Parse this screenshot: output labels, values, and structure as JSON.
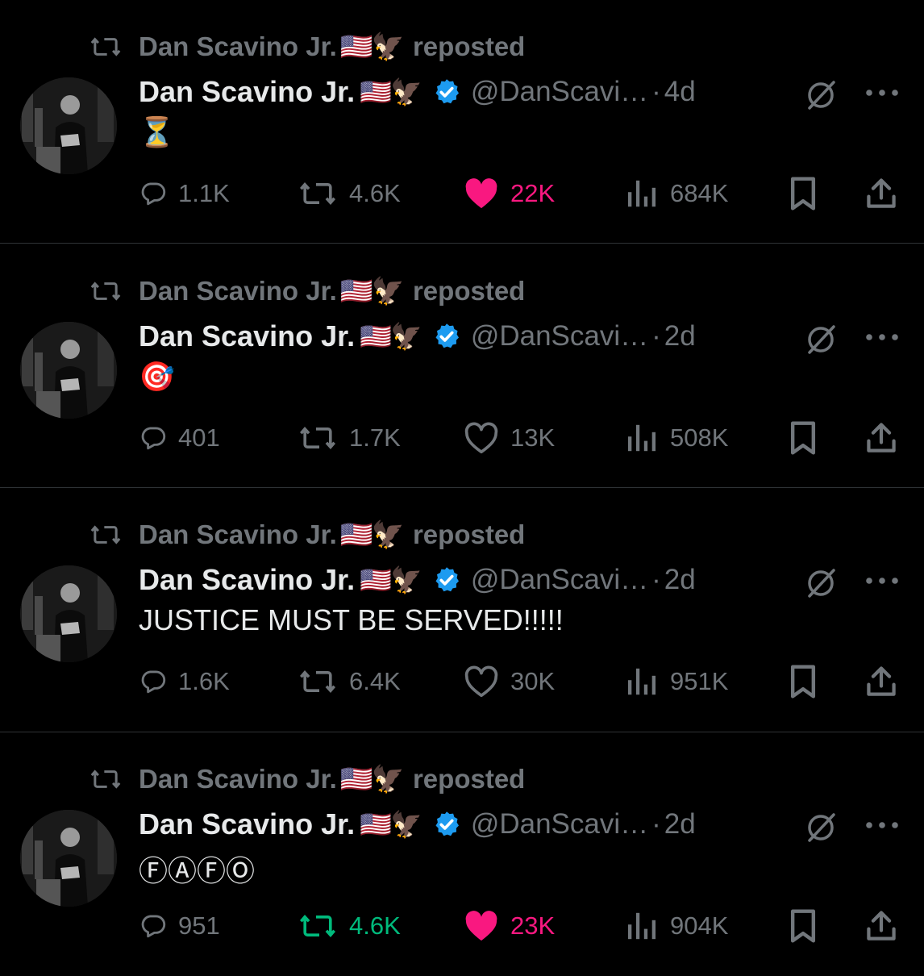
{
  "colors": {
    "background": "#000000",
    "text_primary": "#e7e9ea",
    "text_secondary": "#71767b",
    "verified": "#1d9bf0",
    "like_active": "#f91880",
    "retweet_active": "#00ba7c",
    "divider": "#2f3336"
  },
  "posts": [
    {
      "repost_label": "reposted",
      "repost_name": "Dan Scavino Jr.",
      "repost_emoji": "🇺🇸🦅",
      "author": "Dan Scavino Jr.",
      "author_emoji": "🇺🇸🦅",
      "handle": "@DanScavi…",
      "time": "4d",
      "text": "⏳",
      "replies": "1.1K",
      "reposts": "4.6K",
      "likes": "22K",
      "views": "684K",
      "liked": true,
      "reposted": false
    },
    {
      "repost_label": "reposted",
      "repost_name": "Dan Scavino Jr.",
      "repost_emoji": "🇺🇸🦅",
      "author": "Dan Scavino Jr.",
      "author_emoji": "🇺🇸🦅",
      "handle": "@DanScavi…",
      "time": "2d",
      "text": "🎯",
      "replies": "401",
      "reposts": "1.7K",
      "likes": "13K",
      "views": "508K",
      "liked": false,
      "reposted": false
    },
    {
      "repost_label": "reposted",
      "repost_name": "Dan Scavino Jr.",
      "repost_emoji": "🇺🇸🦅",
      "author": "Dan Scavino Jr.",
      "author_emoji": "🇺🇸🦅",
      "handle": "@DanScavi…",
      "time": "2d",
      "text": "JUSTICE MUST BE SERVED!!!!!",
      "replies": "1.6K",
      "reposts": "6.4K",
      "likes": "30K",
      "views": "951K",
      "liked": false,
      "reposted": false
    },
    {
      "repost_label": "reposted",
      "repost_name": "Dan Scavino Jr.",
      "repost_emoji": "🇺🇸🦅",
      "author": "Dan Scavino Jr.",
      "author_emoji": "🇺🇸🦅",
      "handle": "@DanScavi…",
      "time": "2d",
      "text": "ⒻⒶⒻⓄ",
      "replies": "951",
      "reposts": "4.6K",
      "likes": "23K",
      "views": "904K",
      "liked": true,
      "reposted": true
    }
  ]
}
